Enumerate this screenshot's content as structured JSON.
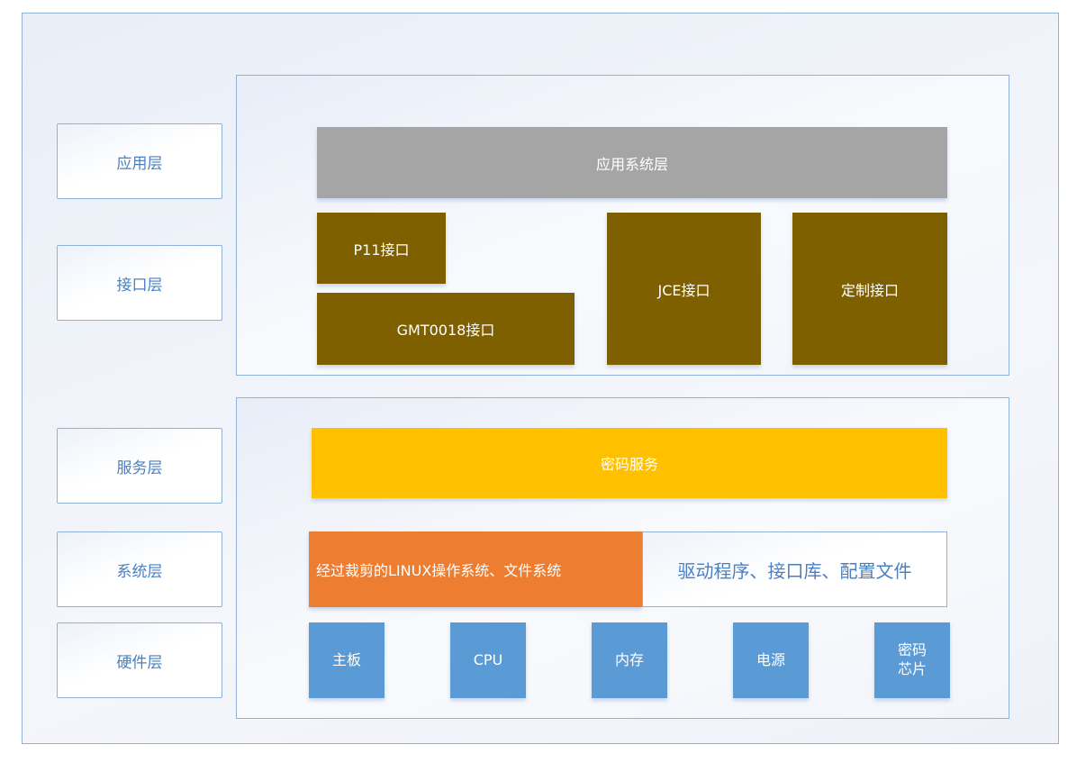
{
  "layers": [
    "应用层",
    "接口层",
    "服务层",
    "系统层",
    "硬件层"
  ],
  "app_system": "应用系统层",
  "interfaces": {
    "p11": "P11接口",
    "gmt": "GMT0018接口",
    "jce": "JCE接口",
    "custom": "定制接口"
  },
  "crypto_service": "密码服务",
  "os": "经过裁剪的LINUX操作系统、文件系统",
  "drivers": "驱动程序、接口库、配置文件",
  "hardware": [
    "主板",
    "CPU",
    "内存",
    "电源",
    "密码\n芯片"
  ],
  "colors": {
    "gray": "#a5a5a5",
    "brown": "#7f6000",
    "yellow": "#ffc000",
    "orange": "#ed7d31",
    "blue": "#5b9bd5",
    "border": "#8fb2d8"
  }
}
